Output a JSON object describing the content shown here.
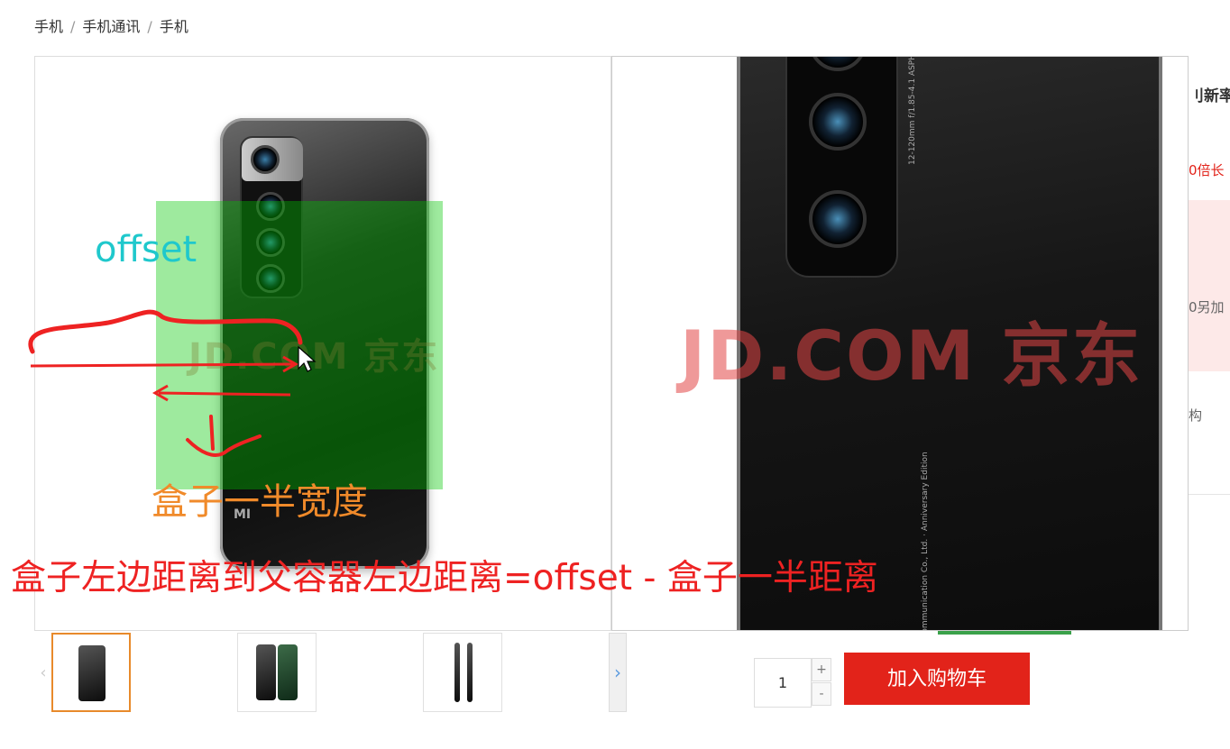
{
  "breadcrumb": {
    "items": [
      "手机",
      "手机通讯",
      "手机"
    ],
    "separator": "/"
  },
  "preview": {
    "watermark": "JD.COM 京东",
    "brand_mark": "MI"
  },
  "annotations": {
    "offset_label": "offset",
    "half_width_label": "盒子一半宽度",
    "formula": "盒子左边距离到父容器左边距离=offset - 盒子一半距离",
    "colors": {
      "offset": "#1fc8cc",
      "half_width": "#f08a2a",
      "formula": "#ee2222",
      "mask": "#00c800"
    }
  },
  "zoom": {
    "watermark": "JD.COM 京东",
    "lens_text": "12-120mm f/1.85-4.1 ASPH",
    "fine_print": "mi Communication Co., Ltd. · Anniversary Edition"
  },
  "side_info": {
    "title_fragment": "刂新率",
    "promo_fragment": "0倍长",
    "price_fragment": "0另加",
    "buy_fragment": "构"
  },
  "thumbnails": {
    "prev_icon": "chevron-left-icon",
    "next_icon": "chevron-right-icon",
    "active_index": 0,
    "count": 3
  },
  "purchase": {
    "quantity": "1",
    "plus": "+",
    "minus": "-",
    "add_to_cart": "加入购物车",
    "accent_color": "#e2231a"
  }
}
